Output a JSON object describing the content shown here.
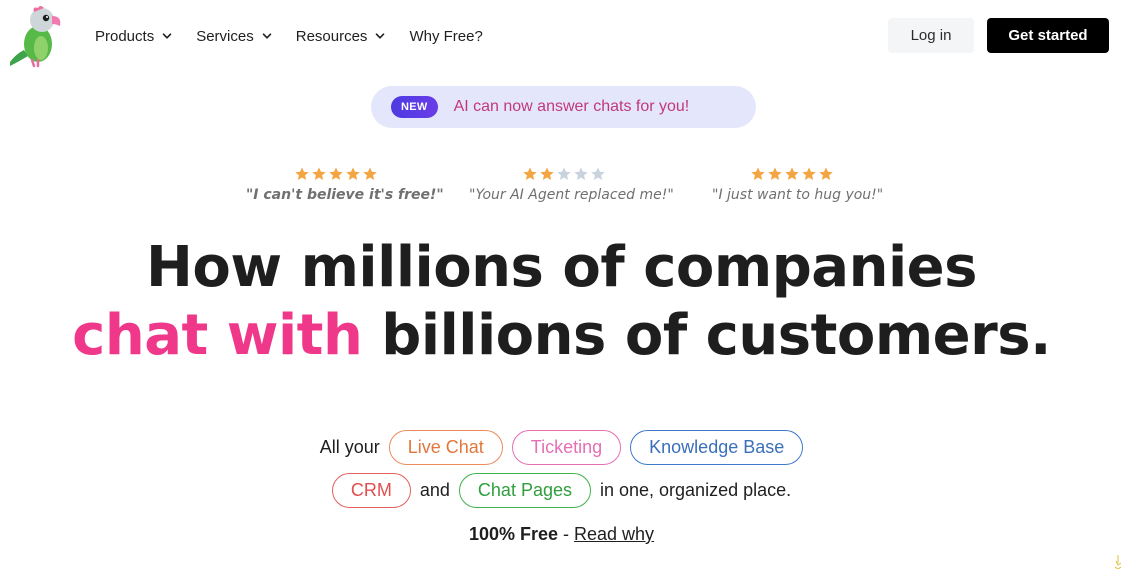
{
  "header": {
    "nav": [
      {
        "label": "Products",
        "has_dropdown": true
      },
      {
        "label": "Services",
        "has_dropdown": true
      },
      {
        "label": "Resources",
        "has_dropdown": true
      },
      {
        "label": "Why Free?",
        "has_dropdown": false
      }
    ],
    "login_label": "Log in",
    "get_started_label": "Get started"
  },
  "announcement": {
    "badge": "NEW",
    "text": "AI can now answer chats for you!"
  },
  "reviews": [
    {
      "rating": 5,
      "max": 5,
      "quote": "\"I can't believe it's free!\""
    },
    {
      "rating": 2,
      "max": 5,
      "quote": "\"Your AI Agent replaced me!\""
    },
    {
      "rating": 5,
      "max": 5,
      "quote": "\"I just want to hug you!\""
    }
  ],
  "headline": {
    "line1": "How millions of companies",
    "line2_accent": "chat with",
    "line2_rest": " billions of customers."
  },
  "products": {
    "prefix": "All your",
    "pills": [
      "Live Chat",
      "Ticketing",
      "Knowledge Base",
      "CRM",
      "Chat Pages"
    ],
    "conjunction": "and",
    "suffix": "in one, organized place."
  },
  "free": {
    "bold": "100% Free",
    "separator": " - ",
    "link": "Read why"
  },
  "colors": {
    "accent_pink": "#f0388a",
    "star_filled": "#f2a541",
    "star_empty": "#c9d3de",
    "live_chat": "#e2773e",
    "ticketing": "#e56fb5",
    "knowledge_base": "#3a6fba",
    "crm": "#e24d4d",
    "chat_pages": "#2f9e3c"
  },
  "icons": [
    "parrot-logo-icon",
    "chevron-down-icon",
    "star-icon"
  ]
}
